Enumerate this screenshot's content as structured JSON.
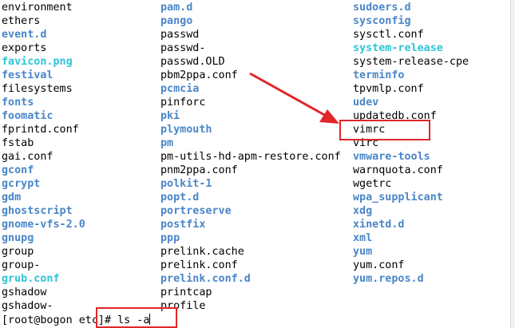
{
  "terminal": {
    "column1": [
      {
        "text": "environment",
        "type": "file"
      },
      {
        "text": "ethers",
        "type": "file"
      },
      {
        "text": "event.d",
        "type": "dir"
      },
      {
        "text": "exports",
        "type": "file"
      },
      {
        "text": "favicon.png",
        "type": "link"
      },
      {
        "text": "festival",
        "type": "dir"
      },
      {
        "text": "filesystems",
        "type": "file"
      },
      {
        "text": "fonts",
        "type": "dir"
      },
      {
        "text": "foomatic",
        "type": "dir"
      },
      {
        "text": "fprintd.conf",
        "type": "file"
      },
      {
        "text": "fstab",
        "type": "file"
      },
      {
        "text": "gai.conf",
        "type": "file"
      },
      {
        "text": "gconf",
        "type": "dir"
      },
      {
        "text": "gcrypt",
        "type": "dir"
      },
      {
        "text": "gdm",
        "type": "dir"
      },
      {
        "text": "ghostscript",
        "type": "dir"
      },
      {
        "text": "gnome-vfs-2.0",
        "type": "dir"
      },
      {
        "text": "gnupg",
        "type": "dir"
      },
      {
        "text": "group",
        "type": "file"
      },
      {
        "text": "group-",
        "type": "file"
      },
      {
        "text": "grub.conf",
        "type": "link"
      },
      {
        "text": "gshadow",
        "type": "file"
      },
      {
        "text": "gshadow-",
        "type": "file"
      }
    ],
    "column2": [
      {
        "text": "pam.d",
        "type": "dir"
      },
      {
        "text": "pango",
        "type": "dir"
      },
      {
        "text": "passwd",
        "type": "file"
      },
      {
        "text": "passwd-",
        "type": "file"
      },
      {
        "text": "passwd.OLD",
        "type": "file"
      },
      {
        "text": "pbm2ppa.conf",
        "type": "file"
      },
      {
        "text": "pcmcia",
        "type": "dir"
      },
      {
        "text": "pinforc",
        "type": "file"
      },
      {
        "text": "pki",
        "type": "dir"
      },
      {
        "text": "plymouth",
        "type": "dir"
      },
      {
        "text": "pm",
        "type": "dir"
      },
      {
        "text": "pm-utils-hd-apm-restore.conf",
        "type": "file"
      },
      {
        "text": "pnm2ppa.conf",
        "type": "file"
      },
      {
        "text": "polkit-1",
        "type": "dir"
      },
      {
        "text": "popt.d",
        "type": "dir"
      },
      {
        "text": "portreserve",
        "type": "dir"
      },
      {
        "text": "postfix",
        "type": "dir"
      },
      {
        "text": "ppp",
        "type": "dir"
      },
      {
        "text": "prelink.cache",
        "type": "file"
      },
      {
        "text": "prelink.conf",
        "type": "file"
      },
      {
        "text": "prelink.conf.d",
        "type": "dir"
      },
      {
        "text": "printcap",
        "type": "file"
      },
      {
        "text": "profile",
        "type": "file"
      }
    ],
    "column3": [
      {
        "text": "sudoers.d",
        "type": "dir"
      },
      {
        "text": "sysconfig",
        "type": "dir"
      },
      {
        "text": "sysctl.conf",
        "type": "file"
      },
      {
        "text": "system-release",
        "type": "link"
      },
      {
        "text": "system-release-cpe",
        "type": "file"
      },
      {
        "text": "terminfo",
        "type": "dir"
      },
      {
        "text": "tpvmlp.conf",
        "type": "file"
      },
      {
        "text": "udev",
        "type": "dir"
      },
      {
        "text": "updatedb.conf",
        "type": "file"
      },
      {
        "text": "vimrc",
        "type": "file"
      },
      {
        "text": "virc",
        "type": "file"
      },
      {
        "text": "vmware-tools",
        "type": "dir"
      },
      {
        "text": "warnquota.conf",
        "type": "file"
      },
      {
        "text": "wgetrc",
        "type": "file"
      },
      {
        "text": "wpa_supplicant",
        "type": "dir"
      },
      {
        "text": "xdg",
        "type": "dir"
      },
      {
        "text": "xinetd.d",
        "type": "dir"
      },
      {
        "text": "xml",
        "type": "dir"
      },
      {
        "text": "yum",
        "type": "dir"
      },
      {
        "text": "yum.conf",
        "type": "file"
      },
      {
        "text": "yum.repos.d",
        "type": "dir"
      }
    ],
    "prompt": "[root@bogon etc]# ls -a"
  },
  "colors": {
    "background": "#ffffff",
    "text": "#000000",
    "directory": "#4a86c8",
    "symlink": "#2ec4d6",
    "annotation": "#e0262a"
  },
  "annotations": {
    "highlight_boxes": [
      "vimrc",
      "ls -a command"
    ],
    "arrow": "arrow-pointing-to-vimrc"
  }
}
